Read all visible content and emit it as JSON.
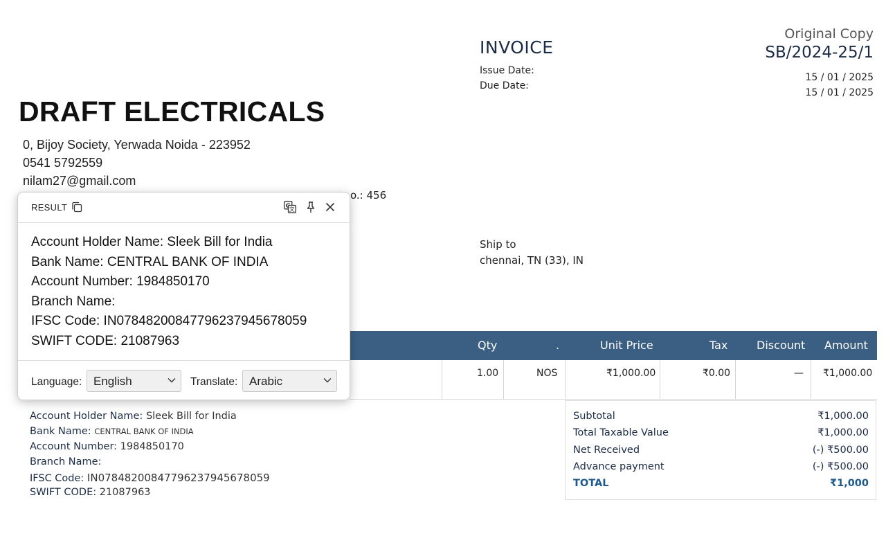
{
  "invoice": {
    "title": "INVOICE",
    "copy_label": "Original Copy",
    "number": "SB/2024-25/1",
    "issue_label": "Issue Date:",
    "due_label": "Due Date:",
    "issue_date": "15 / 01 / 2025",
    "due_date": "15 / 01 / 2025"
  },
  "company": {
    "name": "DRAFT ELECTRICALS",
    "address": "0, Bijoy Society, Yerwada Noida - 223952",
    "phone": "0541 5792559",
    "email": "nilam27@gmail.com",
    "partial_text": "o.: 456"
  },
  "ship_to": {
    "label": "Ship to",
    "value": "chennai, TN (33), IN"
  },
  "table": {
    "headers": [
      "Qty",
      ".",
      "Unit Price",
      "Tax",
      "Discount",
      "Amount"
    ],
    "row": {
      "qty": "1.00",
      "unit": "NOS",
      "unit_price": "₹1,000.00",
      "tax": "₹0.00",
      "discount": "—",
      "amount": "₹1,000.00"
    }
  },
  "bank": {
    "holder_label": "Account Holder Name:",
    "holder_value": "Sleek Bill for India",
    "bank_label": "Bank Name:",
    "bank_value": "CENTRAL BANK OF INDIA",
    "acct_label": "Account Number:",
    "acct_value": "1984850170",
    "branch_label": "Branch Name:",
    "ifsc_label": "IFSC Code:",
    "ifsc_value": "IN07848200847796237945678059",
    "swift_label": "SWIFT CODE:",
    "swift_value": "21087963"
  },
  "totals": {
    "rows": [
      {
        "label": "Subtotal",
        "value": "₹1,000.00"
      },
      {
        "label": "Total Taxable Value",
        "value": "₹1,000.00"
      },
      {
        "label": "Net Received",
        "value": "(-) ₹500.00"
      },
      {
        "label": "Advance payment",
        "value": "(-) ₹500.00"
      }
    ],
    "total_label": "TOTAL",
    "total_value": "₹1,000"
  },
  "popup": {
    "title": "RESULT",
    "lines": [
      "Account Holder Name: Sleek Bill for India",
      "Bank Name: CENTRAL BANK OF INDIA",
      "Account Number: 1984850170",
      "Branch Name:",
      "IFSC Code: IN07848200847796237945678059",
      "SWIFT CODE: 21087963"
    ],
    "language_label": "Language:",
    "language_value": "English",
    "translate_label": "Translate:",
    "translate_value": "Arabic",
    "icons": [
      "copy-icon",
      "translate-icon",
      "pin-icon",
      "close-icon"
    ]
  }
}
